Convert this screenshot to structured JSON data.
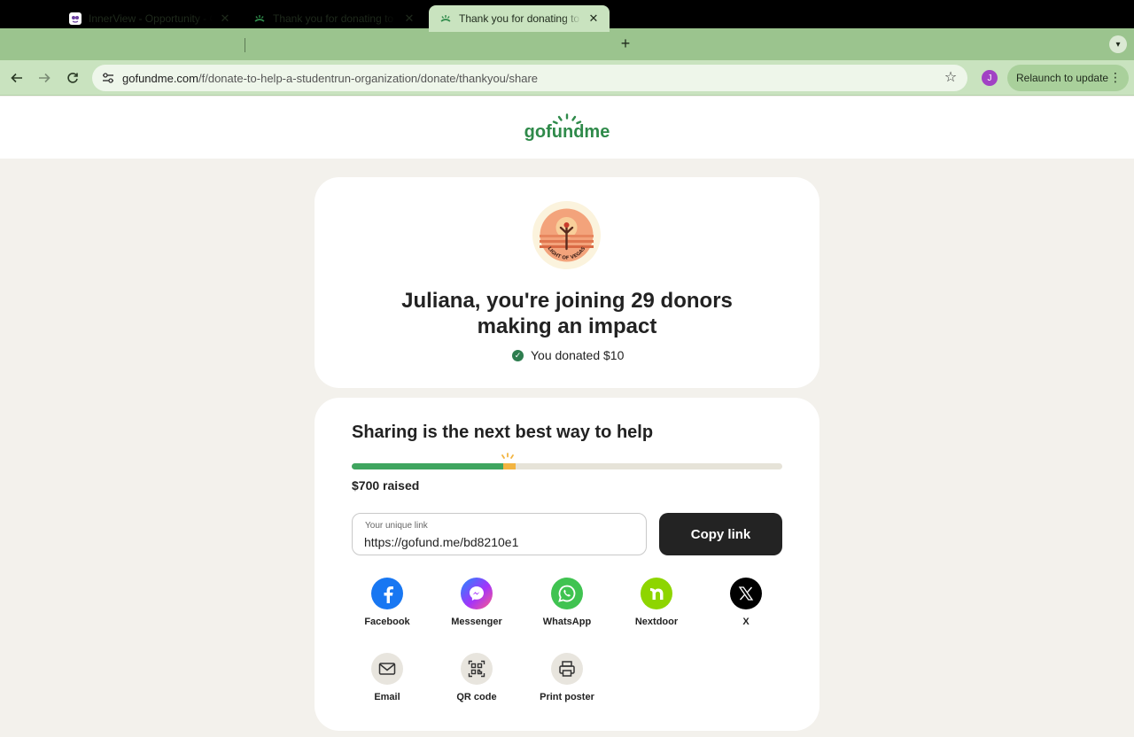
{
  "browser": {
    "tabs": [
      {
        "title": "InnerView - Opportunity - Oct",
        "close": "✕"
      },
      {
        "title": "Thank you for donating to Feed",
        "close": "✕"
      },
      {
        "title": "Thank you for donating to Help",
        "close": "✕"
      }
    ],
    "active_tab": 2,
    "new_tab": "+",
    "url_domain": "gofundme.com",
    "url_path": "/f/donate-to-help-a-studentrun-organization/donate/thankyou/share",
    "profile_initial": "J",
    "relaunch_label": "Relaunch to update"
  },
  "brand": {
    "logo_text": "gofundme",
    "accent": "#3fa55f"
  },
  "thankyou": {
    "headline_line1": "Juliana, you're joining 29 donors",
    "headline_line2": "making an impact",
    "donated_text": "You donated $10",
    "org_logo_text": "LIGHT OF VEGAS"
  },
  "share": {
    "title": "Sharing is the next best way to help",
    "progress": 0.38,
    "raised_text": "$700 raised",
    "link_label": "Your unique link",
    "link_value": "https://gofund.me/bd8210e1",
    "copy_label": "Copy link",
    "options": [
      {
        "label": "Facebook",
        "icon": "facebook-icon",
        "color": "#1877f2"
      },
      {
        "label": "Messenger",
        "icon": "messenger-icon",
        "color": "#a334fa"
      },
      {
        "label": "WhatsApp",
        "icon": "whatsapp-icon",
        "color": "#40c351"
      },
      {
        "label": "Nextdoor",
        "icon": "nextdoor-icon",
        "color": "#8ed500"
      },
      {
        "label": "X",
        "icon": "x-icon",
        "color": "#000000"
      },
      {
        "label": "Email",
        "icon": "email-icon",
        "color": "#e8e5de"
      },
      {
        "label": "QR code",
        "icon": "qr-code-icon",
        "color": "#e8e5de"
      },
      {
        "label": "Print poster",
        "icon": "printer-icon",
        "color": "#e8e5de"
      }
    ]
  }
}
